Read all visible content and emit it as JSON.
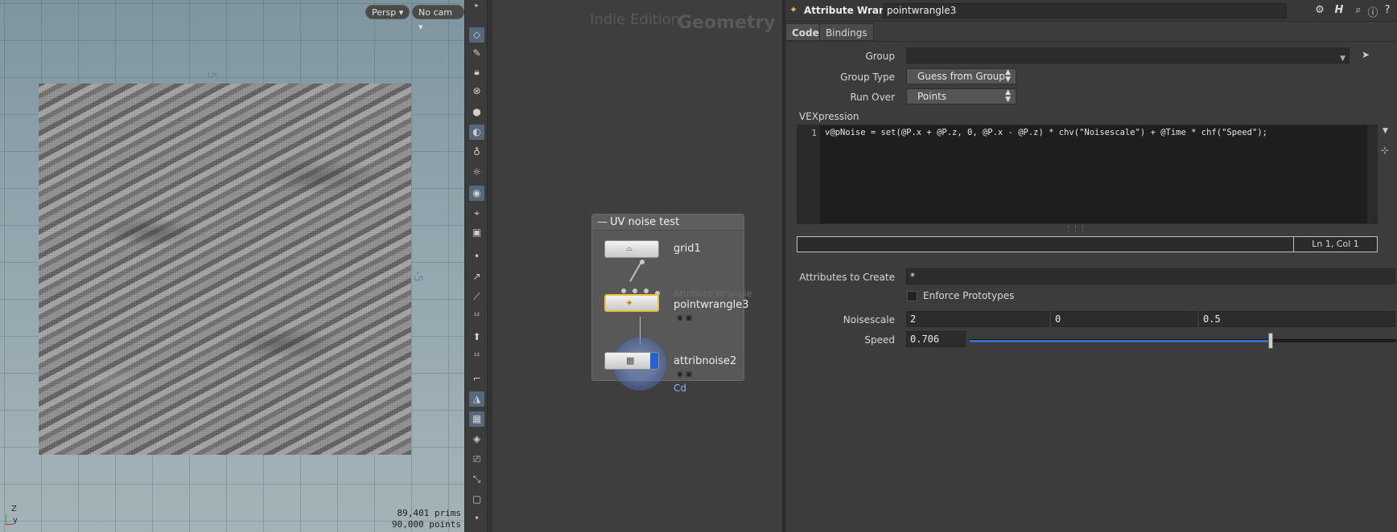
{
  "viewport": {
    "persp_label": "Persp",
    "cam_label": "No cam",
    "axis_top": "5",
    "axis_right": "-5",
    "prims": "89,401  prims",
    "points": "90,000 points",
    "gizmo_z": "Z",
    "gizmo_y": "y"
  },
  "network": {
    "edition": "Indie Edition",
    "context": "Geometry",
    "box_title": "UV noise test",
    "nodes": [
      {
        "name": "grid1",
        "type": ""
      },
      {
        "name": "pointwrangle3",
        "type": "Attribute Wrangle"
      },
      {
        "name": "attribnoise2",
        "type": ""
      }
    ],
    "attr_label": "Cd"
  },
  "params": {
    "node_type": "Attribute Wrangle",
    "node_name": "pointwrangle3",
    "tabs": [
      "Code",
      "Bindings"
    ],
    "group_label": "Group",
    "group_value": "",
    "group_type_label": "Group Type",
    "group_type_value": "Guess from Group",
    "run_over_label": "Run Over",
    "run_over_value": "Points",
    "vex_label": "VEXpression",
    "line_number": "1",
    "code": "v@pNoise = set(@P.x + @P.z, 0, @P.x - @P.z) * chv(\"Noisescale\") + @Time * chf(\"Speed\");",
    "cursor_pos": "Ln 1, Col 1",
    "attrs_label": "Attributes to Create",
    "attrs_value": "*",
    "enforce_label": "Enforce Prototypes",
    "noisescale_label": "Noisescale",
    "noisescale": [
      "2",
      "0",
      "0.5"
    ],
    "speed_label": "Speed",
    "speed_value": "0.706",
    "speed_fraction": 0.706
  }
}
